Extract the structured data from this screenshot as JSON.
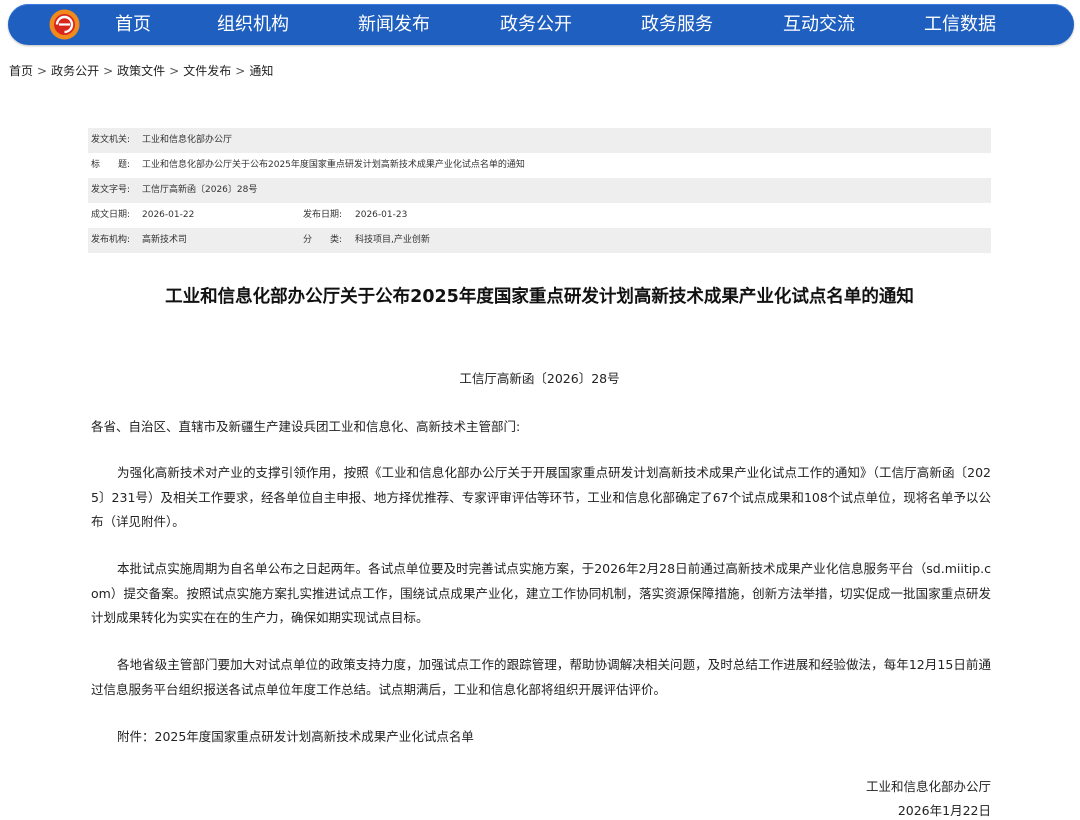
{
  "nav": {
    "items": [
      "首页",
      "组织机构",
      "新闻发布",
      "政务公开",
      "政务服务",
      "互动交流",
      "工信数据"
    ],
    "colors": {
      "bar": "#1f5fc0",
      "logo_orange": "#f08a1c",
      "logo_red": "#d9261c"
    }
  },
  "breadcrumb": [
    "首页",
    "政务公开",
    "政策文件",
    "文件发布",
    "通知"
  ],
  "meta": {
    "issuer_label": "发文机关:",
    "issuer": "工业和信息化部办公厅",
    "title_label": "标　　题:",
    "title": "工业和信息化部办公厅关于公布2025年度国家重点研发计划高新技术成果产业化试点名单的通知",
    "doc_no_label": "发文字号:",
    "doc_no": "工信厅高新函〔2026〕28号",
    "written_label": "成文日期:",
    "written": "2026-01-22",
    "published_label": "发布日期:",
    "published": "2026-01-23",
    "org_label": "发布机构:",
    "org": "高新技术司",
    "category_label": "分　　类:",
    "category": "科技项目,产业创新"
  },
  "doc": {
    "title": "工业和信息化部办公厅关于公布2025年度国家重点研发计划高新技术成果产业化试点名单的通知",
    "number": "工信厅高新函〔2026〕28号",
    "salutation": "各省、自治区、直辖市及新疆生产建设兵团工业和信息化、高新技术主管部门:",
    "paragraphs": [
      "为强化高新技术对产业的支撑引领作用，按照《工业和信息化部办公厅关于开展国家重点研发计划高新技术成果产业化试点工作的通知》（工信厅高新函〔2025〕231号）及相关工作要求，经各单位自主申报、地方择优推荐、专家评审评估等环节，工业和信息化部确定了67个试点成果和108个试点单位，现将名单予以公布（详见附件）。",
      "本批试点实施周期为自名单公布之日起两年。各试点单位要及时完善试点实施方案，于2026年2月28日前通过高新技术成果产业化信息服务平台（sd.miitip.com）提交备案。按照试点实施方案扎实推进试点工作，围绕试点成果产业化，建立工作协同机制，落实资源保障措施，创新方法举措，切实促成一批国家重点研发计划成果转化为实实在在的生产力，确保如期实现试点目标。",
      "各地省级主管部门要加大对试点单位的政策支持力度，加强试点工作的跟踪管理，帮助协调解决相关问题，及时总结工作进展和经验做法，每年12月15日前通过信息服务平台组织报送各试点单位年度工作总结。试点期满后，工业和信息化部将组织开展评估评价。",
      "附件：2025年度国家重点研发计划高新技术成果产业化试点名单"
    ],
    "signature": "工业和信息化部办公厅",
    "date": "2026年1月22日"
  }
}
